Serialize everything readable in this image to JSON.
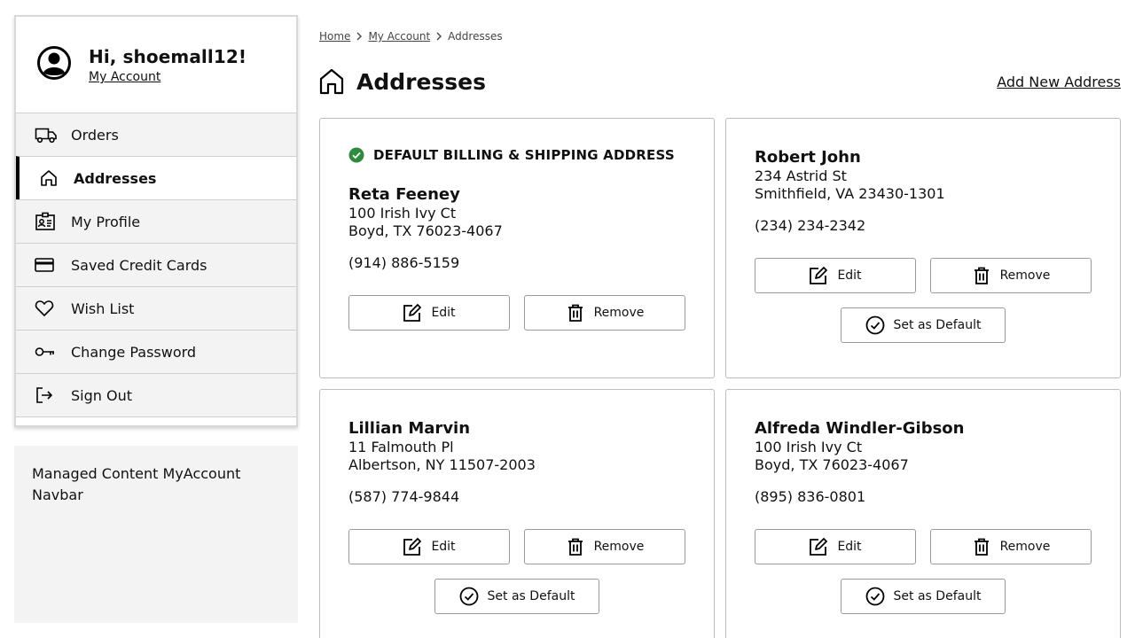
{
  "sidebar": {
    "greeting": "Hi, shoemall12!",
    "account_link": "My Account",
    "items": [
      {
        "label": "Orders",
        "icon": "truck-icon"
      },
      {
        "label": "Addresses",
        "icon": "home-icon"
      },
      {
        "label": "My Profile",
        "icon": "id-card-icon"
      },
      {
        "label": "Saved Credit Cards",
        "icon": "credit-card-icon"
      },
      {
        "label": "Wish List",
        "icon": "heart-icon"
      },
      {
        "label": "Change Password",
        "icon": "key-icon"
      },
      {
        "label": "Sign Out",
        "icon": "sign-out-icon"
      }
    ],
    "managed_content": "Managed Content MyAccount Navbar"
  },
  "breadcrumb": {
    "home": "Home",
    "account": "My Account",
    "current": "Addresses"
  },
  "page": {
    "title": "Addresses",
    "add_link": "Add New Address"
  },
  "buttons": {
    "edit": "Edit",
    "remove": "Remove",
    "set_default": "Set as Default"
  },
  "addresses": [
    {
      "default_label": "DEFAULT BILLING & SHIPPING ADDRESS",
      "name": "Reta Feeney",
      "line1": "100 Irish Ivy Ct",
      "line2": "Boyd, TX 76023-4067",
      "phone": "(914) 886-5159"
    },
    {
      "name": "Robert John",
      "line1": "234 Astrid St",
      "line2": "Smithfield, VA 23430-1301",
      "phone": "(234) 234-2342"
    },
    {
      "name": "Lillian Marvin",
      "line1": "11 Falmouth Pl",
      "line2": "Albertson, NY 11507-2003",
      "phone": "(587) 774-9844"
    },
    {
      "name": "Alfreda Windler-Gibson",
      "line1": "100 Irish Ivy Ct",
      "line2": "Boyd, TX 76023-4067",
      "phone": "(895) 836-0801"
    }
  ],
  "colors": {
    "default_check": "#2e8b3f",
    "active_bar": "#000000",
    "nav_bg": "#f3f3f3"
  }
}
